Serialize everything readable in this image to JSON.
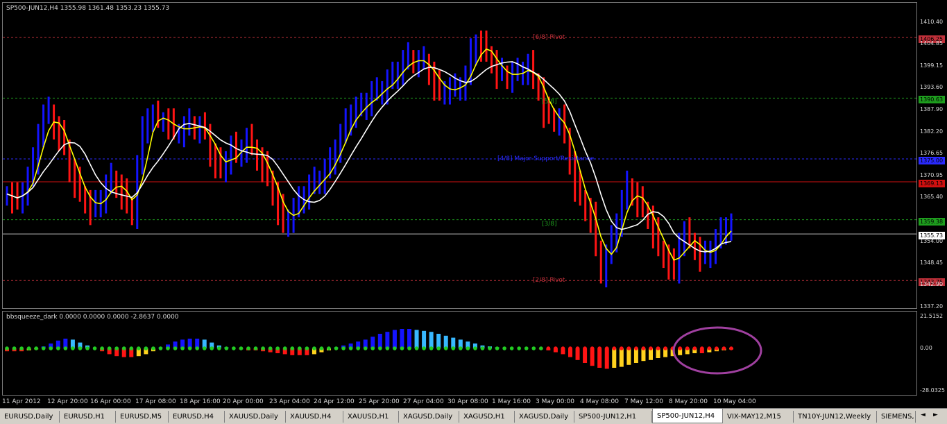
{
  "chart": {
    "header": "SP500-JUN12,H4   1355.98 1361.48 1353.23 1355.73",
    "current_price": "1355.73",
    "colors": {
      "background": "#000000",
      "bull": "#1414ff",
      "bear": "#ff1414",
      "ma_fast": "#ffff00",
      "ma_slow": "#ffffff",
      "grid": "#7a7a7a",
      "ellipse": "#a040a0"
    }
  },
  "chart_data": [
    {
      "type": "bar",
      "title": "SP500-JUN12,H4",
      "price_axis_ticks": [
        "1410.40",
        "1404.85",
        "1399.15",
        "1393.60",
        "1387.90",
        "1382.20",
        "1376.65",
        "1370.95",
        "1365.40",
        "1354.00",
        "1348.45",
        "1342.90",
        "1337.20"
      ],
      "ylim": [
        1337.2,
        1413.0
      ],
      "x_ticks": [
        "11 Apr 2012",
        "12 Apr 20:00",
        "16 Apr 00:00",
        "17 Apr 08:00",
        "18 Apr 16:00",
        "20 Apr 00:00",
        "23 Apr 04:00",
        "24 Apr 12:00",
        "25 Apr 20:00",
        "27 Apr 04:00",
        "30 Apr 08:00",
        "1 May 16:00",
        "3 May 00:00",
        "4 May 08:00",
        "7 May 12:00",
        "8 May 20:00",
        "10 May 04:00"
      ],
      "levels": [
        {
          "label": "[6/8] Pivot",
          "value": 1406.25,
          "tag": "1406.25",
          "color": "#c0303a",
          "style": "dashed"
        },
        {
          "label": "[5/8]",
          "value": 1390.63,
          "tag": "1390.63",
          "color": "#1e9e1e",
          "style": "dashed"
        },
        {
          "label": "[4/8] Major Support/Resistance",
          "value": 1375.0,
          "tag": "1375.00",
          "color": "#2a2aff",
          "style": "dashed"
        },
        {
          "label": "",
          "value": 1369.13,
          "tag": "1369.13",
          "color": "#d01010",
          "style": "solid"
        },
        {
          "label": "[3/8]",
          "value": 1359.38,
          "tag": "1359.38",
          "color": "#1e9e1e",
          "style": "dashed"
        },
        {
          "label": "[2/8] Pivot",
          "value": 1343.75,
          "tag": "1343.75",
          "color": "#c0303a",
          "style": "dashed"
        }
      ],
      "closes": [
        1366,
        1365,
        1364,
        1367,
        1370,
        1374,
        1382,
        1386,
        1387,
        1383,
        1381,
        1378,
        1372,
        1369,
        1366,
        1364,
        1362,
        1363,
        1365,
        1368,
        1370,
        1368,
        1366,
        1363,
        1361,
        1373,
        1382,
        1386,
        1386,
        1385,
        1385,
        1384,
        1382,
        1382,
        1383,
        1384,
        1383,
        1383,
        1382,
        1376,
        1374,
        1372,
        1375,
        1378,
        1376,
        1378,
        1380,
        1378,
        1375,
        1373,
        1370,
        1366,
        1362,
        1358,
        1360,
        1362,
        1364,
        1366,
        1368,
        1369,
        1370,
        1372,
        1374,
        1378,
        1381,
        1384,
        1387,
        1388,
        1388,
        1390,
        1392,
        1392,
        1393,
        1395,
        1396,
        1398,
        1400,
        1401,
        1400,
        1400,
        1400,
        1397,
        1394,
        1392,
        1393,
        1393,
        1393,
        1394,
        1396,
        1402,
        1405,
        1404,
        1402,
        1400,
        1397,
        1397,
        1396,
        1397,
        1397,
        1398,
        1399,
        1395,
        1393,
        1387,
        1386,
        1385,
        1385,
        1381,
        1374,
        1368,
        1365,
        1362,
        1360,
        1352,
        1346,
        1350,
        1354,
        1359,
        1364,
        1368,
        1366,
        1364,
        1362,
        1360,
        1356,
        1352,
        1350,
        1348,
        1346,
        1354,
        1356,
        1354,
        1352,
        1350,
        1350,
        1352,
        1354,
        1356,
        1358,
        1358
      ],
      "series": [
        {
          "name": "bbsqueeze_dark",
          "values": [
            -3,
            -3,
            -3,
            -2,
            -1,
            2,
            5,
            8,
            10,
            9,
            6,
            3,
            0,
            -3,
            -6,
            -8,
            -9,
            -9,
            -8,
            -6,
            -3,
            1,
            4,
            7,
            9,
            10,
            10,
            9,
            6,
            3,
            1,
            0,
            -1,
            -2,
            -2,
            -3,
            -4,
            -5,
            -6,
            -7,
            -7,
            -7,
            -6,
            -4,
            -2,
            1,
            3,
            5,
            7,
            9,
            12,
            15,
            17,
            19,
            20,
            20,
            19,
            18,
            17,
            15,
            13,
            11,
            9,
            7,
            5,
            3,
            2,
            1,
            0,
            0,
            0,
            0,
            0,
            -1,
            -2,
            -4,
            -6,
            -9,
            -12,
            -15,
            -18,
            -20,
            -21,
            -20,
            -19,
            -17,
            -15,
            -13,
            -12,
            -10,
            -9,
            -8,
            -7,
            -6,
            -5,
            -5,
            -4,
            -3,
            -2,
            -1
          ]
        }
      ],
      "indicator_label": "bbsqueeze_dark 0.0000 0.0000 0.0000 -2.8637 0.0000",
      "indicator_ticks": [
        "21.5152",
        "0.00",
        "-28.0325"
      ]
    }
  ],
  "tabs": [
    {
      "label": "EURUSD,Daily",
      "active": false
    },
    {
      "label": "EURUSD,H1",
      "active": false
    },
    {
      "label": "EURUSD,M5",
      "active": false
    },
    {
      "label": "EURUSD,H4",
      "active": false
    },
    {
      "label": "XAUUSD,Daily",
      "active": false
    },
    {
      "label": "XAUUSD,H4",
      "active": false
    },
    {
      "label": "XAUUSD,H1",
      "active": false
    },
    {
      "label": "XAGUSD,Daily",
      "active": false
    },
    {
      "label": "XAGUSD,H1",
      "active": false
    },
    {
      "label": "XAGUSD,Daily",
      "active": false
    },
    {
      "label": "SP500-JUN12,H1",
      "active": false
    },
    {
      "label": "SP500-JUN12,H4",
      "active": true
    },
    {
      "label": "VIX-MAY12,M15",
      "active": false
    },
    {
      "label": "TN10Y-JUN12,Weekly",
      "active": false
    },
    {
      "label": "SIEMENS,",
      "active": false
    }
  ],
  "tab_scroll": {
    "left": "◄",
    "right": "►"
  }
}
